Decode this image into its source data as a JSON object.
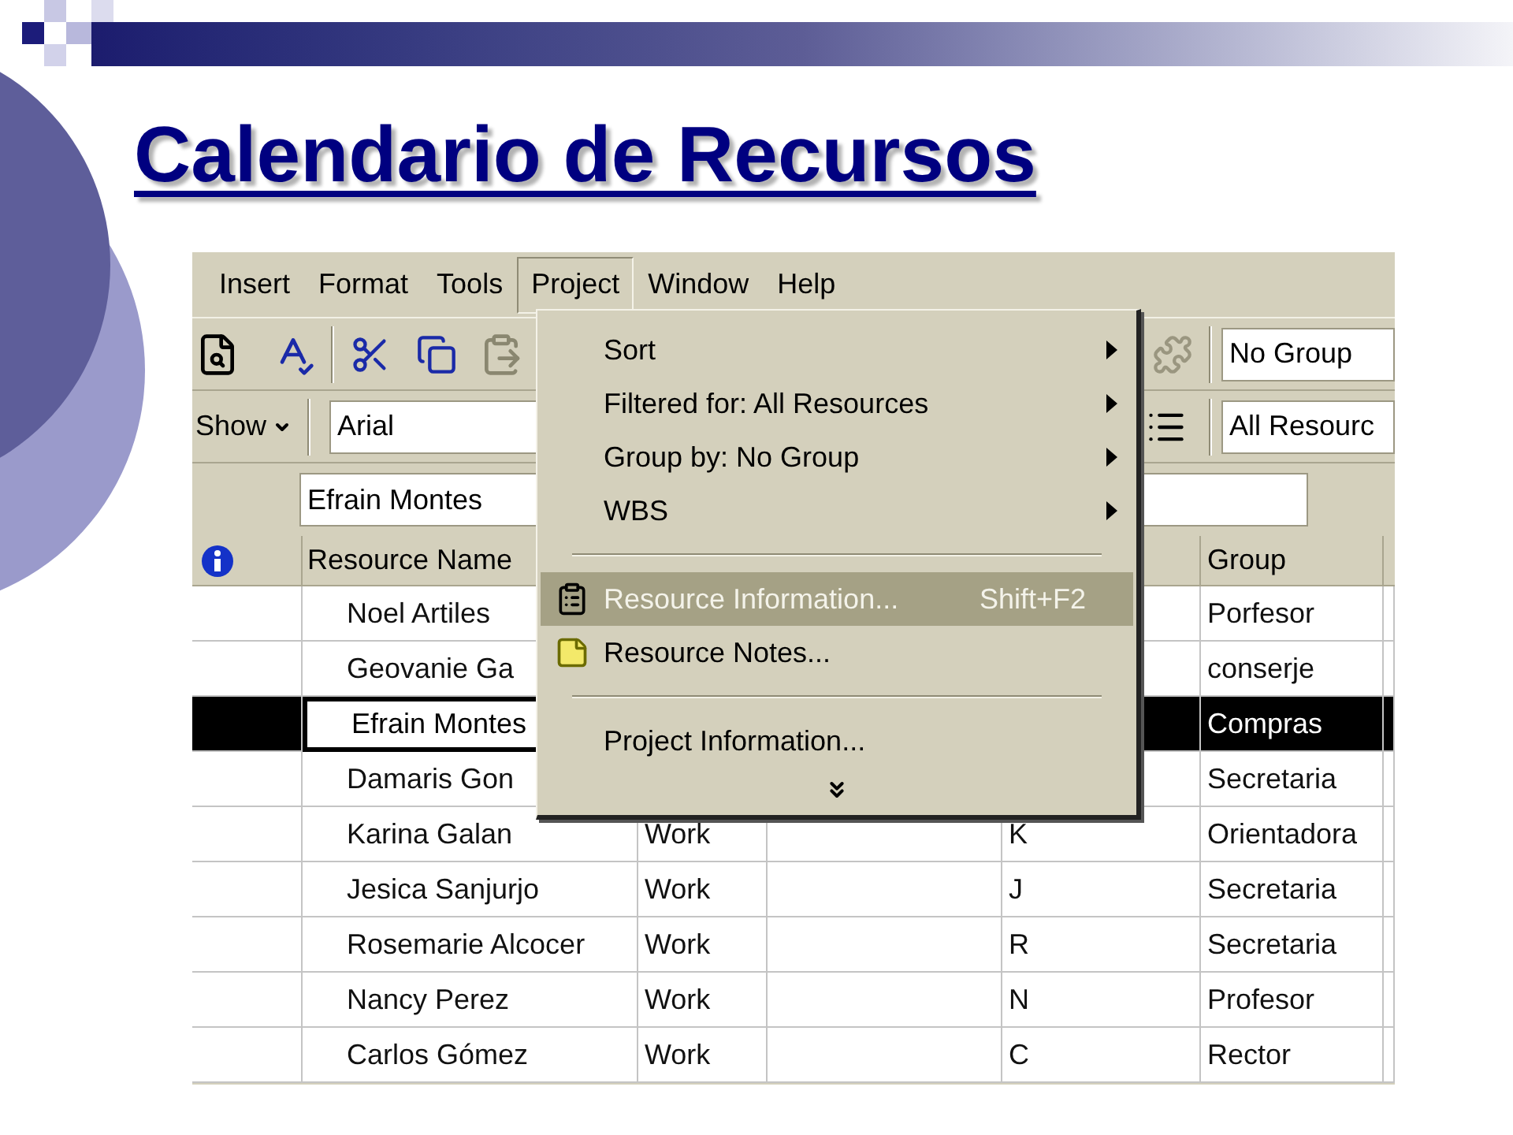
{
  "slide": {
    "title": "Calendario de Recursos"
  },
  "menu_bar": [
    {
      "label": "Insert",
      "selected": false
    },
    {
      "label": "Format",
      "selected": false
    },
    {
      "label": "Tools",
      "selected": false
    },
    {
      "label": "Project",
      "selected": true
    },
    {
      "label": "Window",
      "selected": false
    },
    {
      "label": "Help",
      "selected": false
    }
  ],
  "toolbar": {
    "group_field": "No Group",
    "show_button": "Show",
    "font_field": "Arial",
    "filter_field": "All Resourc"
  },
  "entry_field": "Efrain Montes",
  "project_menu": [
    {
      "kind": "submenu",
      "label": "Sort",
      "selected": false
    },
    {
      "kind": "submenu",
      "label": "Filtered for: All Resources",
      "selected": false
    },
    {
      "kind": "submenu",
      "label": "Group by: No Group",
      "selected": false
    },
    {
      "kind": "submenu",
      "label": "WBS",
      "selected": false
    },
    {
      "kind": "separator"
    },
    {
      "kind": "form",
      "label": "Resource Information...",
      "shortcut": "Shift+F2",
      "selected": true
    },
    {
      "kind": "note",
      "label": "Resource Notes...",
      "selected": false
    },
    {
      "kind": "separator"
    },
    {
      "kind": "command",
      "label": "Project Information...",
      "selected": false
    },
    {
      "kind": "more"
    }
  ],
  "table": {
    "columns": [
      "Resource Name",
      "Group"
    ],
    "rows": [
      {
        "name": "Noel Artiles",
        "group": "Porfesor",
        "selected": false
      },
      {
        "name": "Geovanie Ga",
        "group": "conserje",
        "selected": false
      },
      {
        "name": "Efrain Montes",
        "group": "Compras",
        "selected": true
      },
      {
        "name": "Damaris Gon",
        "group": "Secretaria",
        "selected": false
      },
      {
        "name": "Karina Galan",
        "type": "Work",
        "initials": "K",
        "group": "Orientadora",
        "selected": false
      },
      {
        "name": "Jesica Sanjurjo",
        "type": "Work",
        "initials": "J",
        "group": "Secretaria",
        "selected": false
      },
      {
        "name": "Rosemarie Alcocer",
        "type": "Work",
        "initials": "R",
        "group": "Secretaria",
        "selected": false
      },
      {
        "name": "Nancy Perez",
        "type": "Work",
        "initials": "N",
        "group": "Profesor",
        "selected": false
      },
      {
        "name": "Carlos Gómez",
        "type": "Work",
        "initials": "C",
        "group": "Rector",
        "selected": false
      }
    ]
  }
}
